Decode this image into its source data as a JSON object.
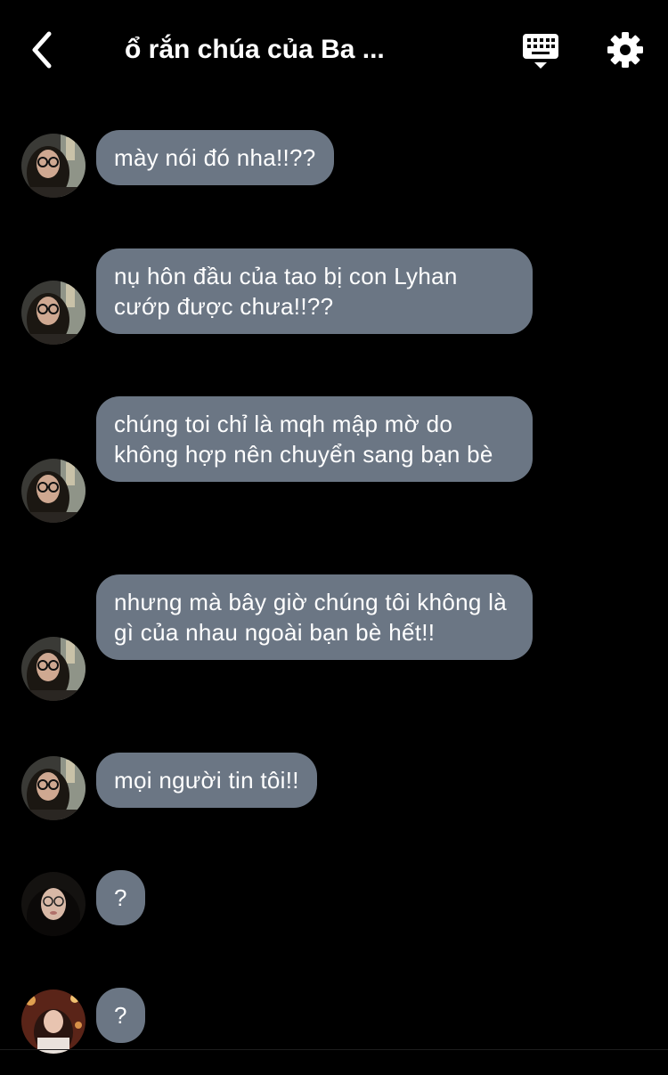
{
  "header": {
    "title": "ổ rắn chúa của Ba ...",
    "back_icon": "chevron-left-icon",
    "keyboard_icon": "keyboard-icon",
    "settings_icon": "gear-icon"
  },
  "colors": {
    "background": "#000000",
    "bubble": "#6b7684",
    "text": "#ffffff"
  },
  "messages": [
    {
      "text": "mày nói đó nha!!??",
      "avatar": "user-photo-glasses"
    },
    {
      "text": "nụ hôn đầu của tao bị con Lyhan cướp được chưa!!??",
      "avatar": "user-photo-glasses"
    },
    {
      "text": "chúng toi chỉ là mqh mập mờ do không hợp nên chuyển sang bạn bè",
      "avatar": "user-photo-glasses"
    },
    {
      "text": "nhưng mà bây giờ chúng tôi không là gì của nhau ngoài bạn bè hết!!",
      "avatar": "user-photo-glasses"
    },
    {
      "text": "mọi người tin tôi!!",
      "avatar": "user-photo-glasses"
    },
    {
      "text": "?",
      "avatar": "user-photo-dark-hair"
    },
    {
      "text": "?",
      "avatar": "user-photo-warm"
    }
  ]
}
